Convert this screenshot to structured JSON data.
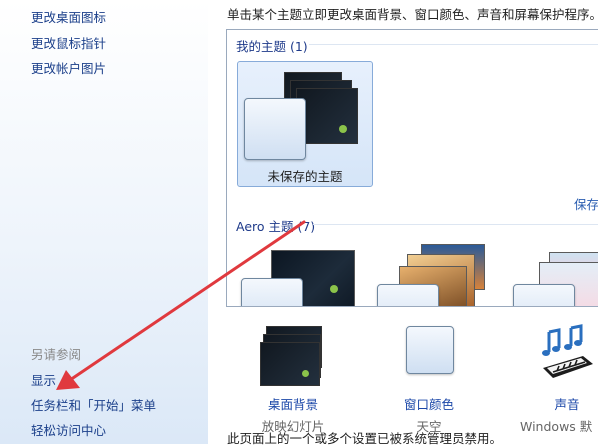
{
  "sidebar": {
    "links": [
      {
        "label": "更改桌面图标"
      },
      {
        "label": "更改鼠标指针"
      },
      {
        "label": "更改帐户图片"
      }
    ],
    "see_also_heading": "另请参阅",
    "see_also": [
      {
        "label": "显示"
      },
      {
        "label": "任务栏和「开始」菜单"
      },
      {
        "label": "轻松访问中心"
      }
    ]
  },
  "main": {
    "instruction": "单击某个主题立即更改桌面背景、窗口颜色、声音和屏幕保护程序。",
    "my_themes_header": "我的主题 (1)",
    "unsaved_theme_label": "未保存的主题",
    "save_link": "保存",
    "aero_header": "Aero 主题 (7)"
  },
  "bottom": {
    "background": {
      "label": "桌面背景",
      "sub": "放映幻灯片"
    },
    "color": {
      "label": "窗口颜色",
      "sub": "天空"
    },
    "sound": {
      "label": "声音",
      "sub": "Windows 默"
    }
  },
  "footer_note": "此页面上的一个或多个设置已被系统管理员禁用。",
  "colors": {
    "link": "#1b3f8a",
    "annotation_arrow": "#e0393e",
    "selection_border": "#87abd9"
  },
  "icons": {
    "background": "slideshow-stack-icon",
    "color": "glass-window-icon",
    "sound": "music-notes-piano-icon"
  }
}
